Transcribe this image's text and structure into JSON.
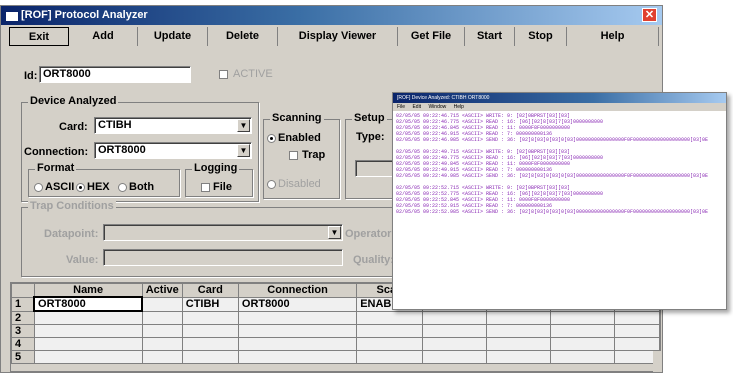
{
  "window": {
    "title": "[ROF] Protocol Analyzer",
    "close_glyph": "✕"
  },
  "menu": [
    {
      "label": "Exit"
    },
    {
      "label": "Add"
    },
    {
      "label": "Update"
    },
    {
      "label": "Delete"
    },
    {
      "label": "Display Viewer"
    },
    {
      "label": "Get File"
    },
    {
      "label": "Start"
    },
    {
      "label": "Stop"
    },
    {
      "label": "Help"
    }
  ],
  "form": {
    "id_label": "Id:",
    "id_value": "ORT8000",
    "active_label": "ACTIVE",
    "device_group": "Device Analyzed",
    "card_label": "Card:",
    "card_value": "CTIBH",
    "connection_label": "Connection:",
    "connection_value": "ORT8000",
    "format_group": "Format",
    "format_options": [
      "ASCII",
      "HEX",
      "Both"
    ],
    "format_selected": "HEX",
    "logging_group": "Logging",
    "logging_file": "File",
    "scanning_group": "Scanning",
    "scan_enabled": "Enabled",
    "scan_trap": "Trap",
    "scan_disabled": "Disabled",
    "setup_group": "Setup",
    "type_label": "Type:",
    "trap_group": "Trap Conditions",
    "datapoint_label": "Datapoint:",
    "value_label": "Value:",
    "operator_label": "Operator:",
    "quality_label": "Quality:"
  },
  "grid": {
    "columns": [
      "",
      "Name",
      "Active",
      "Card",
      "Connection",
      "Scan"
    ],
    "rows": [
      {
        "num": "1",
        "name": "ORT8000",
        "active": "",
        "card": "CTIBH",
        "connection": "ORT8000",
        "scan": "ENABL"
      },
      {
        "num": "2",
        "name": "",
        "active": "",
        "card": "",
        "connection": "",
        "scan": ""
      },
      {
        "num": "3",
        "name": "",
        "active": "",
        "card": "",
        "connection": "",
        "scan": ""
      },
      {
        "num": "4",
        "name": "",
        "active": "",
        "card": "",
        "connection": "",
        "scan": ""
      },
      {
        "num": "5",
        "name": "",
        "active": "",
        "card": "",
        "connection": "",
        "scan": ""
      }
    ]
  },
  "viewer": {
    "title": "[ROF] Device Analyzed: CTIBH ORT8000",
    "menu": [
      "File",
      "Edit",
      "Window",
      "Help"
    ],
    "blocks": [
      [
        "02/05/05 09:22:46.715 <ASCII> WRITE: 9: [02]0BPRST[03][03]",
        "02/05/05 09:22:46.775 <ASCII> READ : 16: [06][02]8[03]7[03]0000008000",
        "02/05/05 09:22:46.845 <ASCII> READ : 11: 0000F8F0000000000",
        "02/05/05 09:22:46.915 <ASCII> READ : 7: 000000000136",
        "02/05/05 09:22:46.985 <ASCII> SEND : 36: [02]8[03]0[03]0[03]0000000000000000F0F0000000000000000000[03]0E"
      ],
      [
        "02/05/05 09:22:49.715 <ASCII> WRITE: 9: [02]0BPRST[03][03]",
        "02/05/05 09:22:49.775 <ASCII> READ : 16: [06][02]8[03]7[03]0000008000",
        "02/05/05 09:22:49.845 <ASCII> READ : 11: 0000F8F0000000000",
        "02/05/05 09:22:49.915 <ASCII> READ : 7: 000000000136",
        "02/05/05 09:22:49.985 <ASCII> SEND : 36: [02]8[03]0[03]0[03]0000000000000000F0F0000000000000000000[03]0E"
      ],
      [
        "02/05/05 09:22:52.715 <ASCII> WRITE: 9: [02]0BPRST[03][03]",
        "02/05/05 09:22:52.775 <ASCII> READ : 16: [06][02]8[03]7[03]0000008000",
        "02/05/05 09:22:52.845 <ASCII> READ : 11: 0000F8F0000000000",
        "02/05/05 09:22:52.915 <ASCII> READ : 7: 000000000136",
        "02/05/05 09:22:52.985 <ASCII> SEND : 36: [02]8[03]0[03]0[03]0000000000000000F0F0000000000000000000[03]0E"
      ]
    ]
  },
  "colors": {
    "window_bg": "#d4d0c8",
    "title_start": "#0a246a",
    "title_end": "#a6caf0",
    "close_red": "#e04030",
    "log_text": "#8a2bb5"
  }
}
